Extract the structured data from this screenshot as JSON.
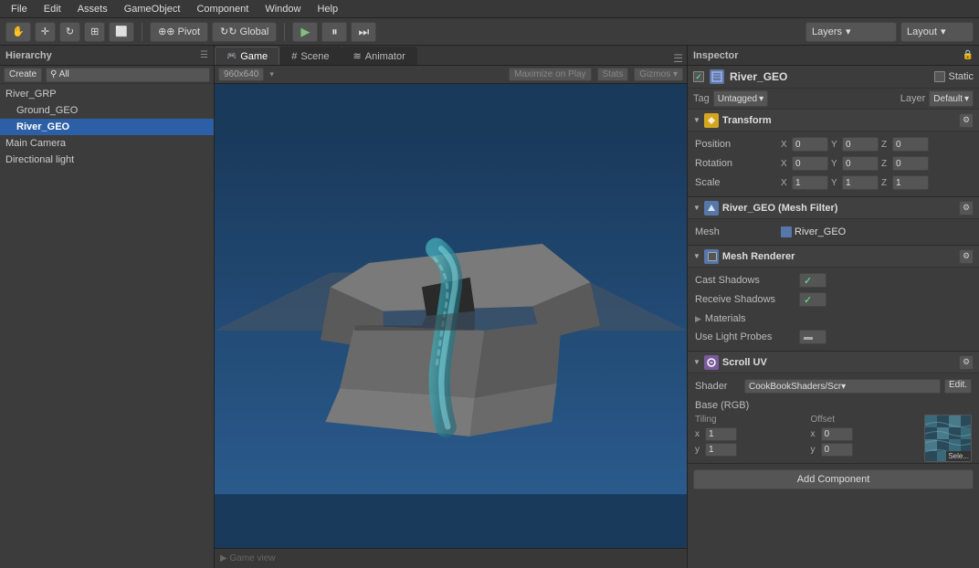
{
  "menubar": {
    "items": [
      "File",
      "Edit",
      "Assets",
      "GameObject",
      "Component",
      "Window",
      "Help"
    ]
  },
  "toolbar": {
    "pivot_label": "⊕ Pivot",
    "global_label": "↻ Global",
    "play_label": "▶",
    "pause_label": "⏸",
    "step_label": "⏭",
    "layers_label": "Layers",
    "layout_label": "Layout"
  },
  "hierarchy": {
    "title": "Hierarchy",
    "create_label": "Create",
    "search_placeholder": "⚲ All",
    "items": [
      {
        "label": "River_GRP",
        "indent": 0,
        "selected": false
      },
      {
        "label": "Ground_GEO",
        "indent": 1,
        "selected": false
      },
      {
        "label": "River_GEO",
        "indent": 1,
        "selected": true,
        "bold": true
      },
      {
        "label": "Main Camera",
        "indent": 0,
        "selected": false
      },
      {
        "label": "Directional light",
        "indent": 0,
        "selected": false
      }
    ]
  },
  "tabs": {
    "game": {
      "label": "Game",
      "icon": "🎮"
    },
    "scene": {
      "label": "Scene",
      "icon": "#"
    },
    "animator": {
      "label": "Animator",
      "icon": "≋"
    }
  },
  "game_view": {
    "resolution": "960x640",
    "maximize_label": "Maximize on Play",
    "stats_label": "Stats",
    "gizmos_label": "Gizmos ▾"
  },
  "inspector": {
    "title": "Inspector",
    "object_name": "River_GEO",
    "static_label": "Static",
    "tag_label": "Tag",
    "tag_value": "Untagged",
    "layer_label": "Layer",
    "layer_value": "Default",
    "components": {
      "transform": {
        "name": "Transform",
        "position": {
          "x": "0",
          "y": "0",
          "z": "0"
        },
        "rotation": {
          "x": "0",
          "y": "0",
          "z": "0"
        },
        "scale": {
          "x": "1",
          "y": "1",
          "z": "1"
        }
      },
      "mesh_filter": {
        "name": "River_GEO (Mesh Filter)",
        "mesh_label": "Mesh",
        "mesh_value": "River_GEO"
      },
      "mesh_renderer": {
        "name": "Mesh Renderer",
        "cast_shadows_label": "Cast Shadows",
        "cast_shadows_value": "✓",
        "receive_shadows_label": "Receive Shadows",
        "receive_shadows_value": "✓",
        "materials_label": "Materials",
        "use_light_probes_label": "Use Light Probes"
      },
      "scroll_uv": {
        "name": "Scroll UV",
        "shader_label": "Shader",
        "shader_value": "CookBookShaders/Scr▾",
        "shader_edit": "Edit.",
        "base_rgb_label": "Base (RGB)",
        "tiling_label": "Tiling",
        "offset_label": "Offset",
        "tiling_x": "1",
        "tiling_y": "1",
        "offset_x": "0",
        "offset_y": "0",
        "select_label": "Sele..."
      }
    },
    "add_component_label": "Add Component"
  }
}
